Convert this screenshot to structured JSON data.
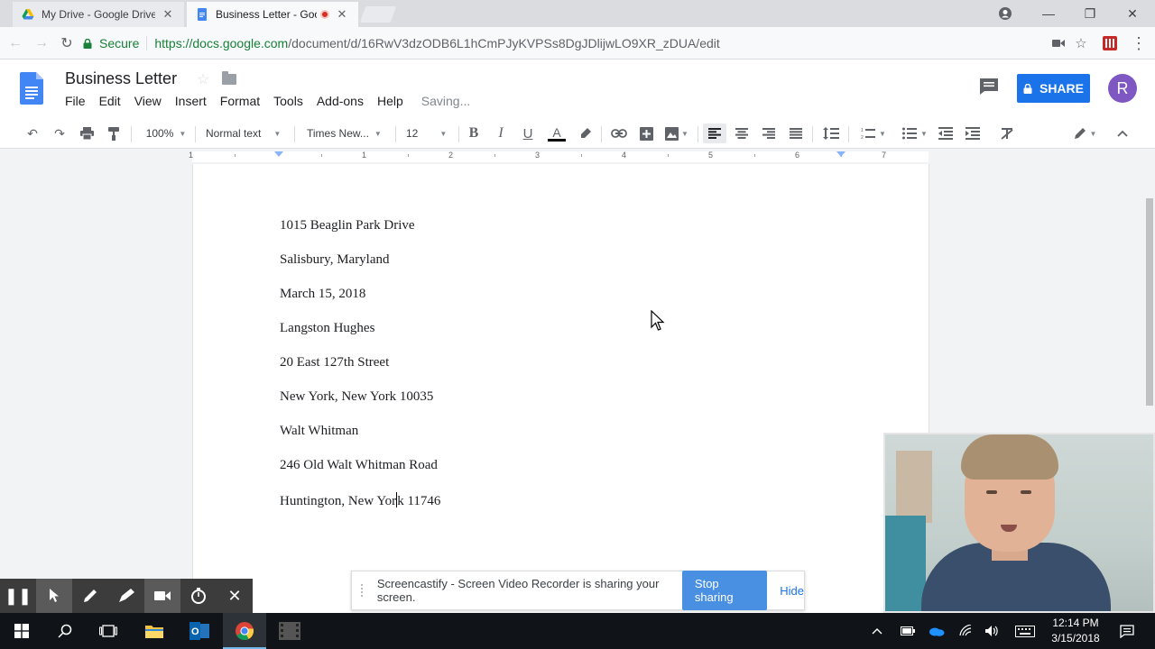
{
  "browser": {
    "tabs": [
      {
        "title": "My Drive - Google Drive",
        "active": false
      },
      {
        "title": "Business Letter - Goo",
        "active": true
      }
    ],
    "secure_label": "Secure",
    "url_host": "https://docs.google.com",
    "url_path": "/document/d/16RwV3dzODB6L1hCmPJyKVPSs8DgJDlijwLO9XR_zDUA/edit"
  },
  "docs": {
    "title": "Business Letter",
    "menu": [
      "File",
      "Edit",
      "View",
      "Insert",
      "Format",
      "Tools",
      "Add-ons",
      "Help"
    ],
    "save_status": "Saving...",
    "share_label": "SHARE",
    "avatar_initial": "R",
    "accent_color": "#1a73e8",
    "avatar_color": "#7e57c2"
  },
  "toolbar": {
    "zoom": "100%",
    "style": "Normal text",
    "font": "Times New...",
    "font_size": "12"
  },
  "ruler": {
    "labels": [
      "1",
      "1",
      "2",
      "3",
      "4",
      "5",
      "6",
      "7"
    ]
  },
  "document": {
    "lines": [
      "1015 Beaglin Park Drive",
      "Salisbury, Maryland",
      "March 15, 2018",
      "Langston Hughes",
      "20 East 127th Street",
      "New York, New York 10035",
      "Walt Whitman",
      "246 Old Walt Whitman Road"
    ],
    "last_line_before_cursor": "Huntington, New Yor",
    "last_line_after_cursor": "k 11746"
  },
  "screencastify": {
    "message": "Screencastify - Screen Video Recorder is sharing your screen.",
    "stop_label": "Stop sharing",
    "hide_label": "Hide"
  },
  "taskbar": {
    "time": "12:14 PM",
    "date": "3/15/2018"
  }
}
